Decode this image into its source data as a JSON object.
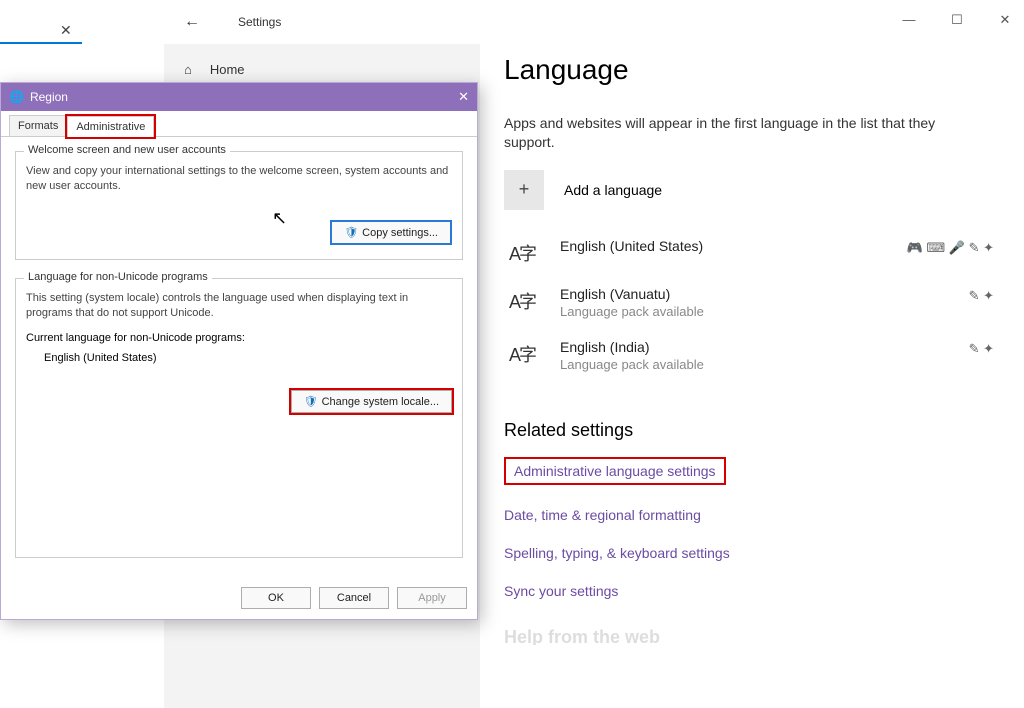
{
  "bg": {
    "close_x": "✕"
  },
  "settings": {
    "back_arrow": "←",
    "title": "Settings",
    "controls": {
      "min": "—",
      "max": "☐",
      "close": "✕"
    },
    "home_icon": "⌂",
    "home_label": "Home"
  },
  "main": {
    "heading": "Language",
    "desc": "Apps and websites will appear in the first language in the list that they support.",
    "add_plus": "+",
    "add_label": "Add a language",
    "langs": [
      {
        "icon": "A字",
        "name": "English (United States)",
        "sub": "",
        "flags": "🎮 ⌨ 🎤 ✎ ✦"
      },
      {
        "icon": "A字",
        "name": "English (Vanuatu)",
        "sub": "Language pack available",
        "flags": "✎ ✦"
      },
      {
        "icon": "A字",
        "name": "English (India)",
        "sub": "Language pack available",
        "flags": "✎ ✦"
      }
    ]
  },
  "related": {
    "heading": "Related settings",
    "links": [
      "Administrative language settings",
      "Date, time & regional formatting",
      "Spelling, typing, & keyboard settings",
      "Sync your settings"
    ]
  },
  "help": {
    "heading": "Help from the web"
  },
  "region": {
    "title": "Region",
    "close": "✕",
    "tabs": {
      "formats": "Formats",
      "admin": "Administrative"
    },
    "welcome": {
      "legend": "Welcome screen and new user accounts",
      "text": "View and copy your international settings to the welcome screen, system accounts and new user accounts.",
      "btn": "Copy settings..."
    },
    "nonuni": {
      "legend": "Language for non-Unicode programs",
      "text": "This setting (system locale) controls the language used when displaying text in programs that do not support Unicode.",
      "curr_label": "Current language for non-Unicode programs:",
      "curr_val": "English (United States)",
      "btn": "Change system locale..."
    },
    "buttons": {
      "ok": "OK",
      "cancel": "Cancel",
      "apply": "Apply"
    }
  }
}
